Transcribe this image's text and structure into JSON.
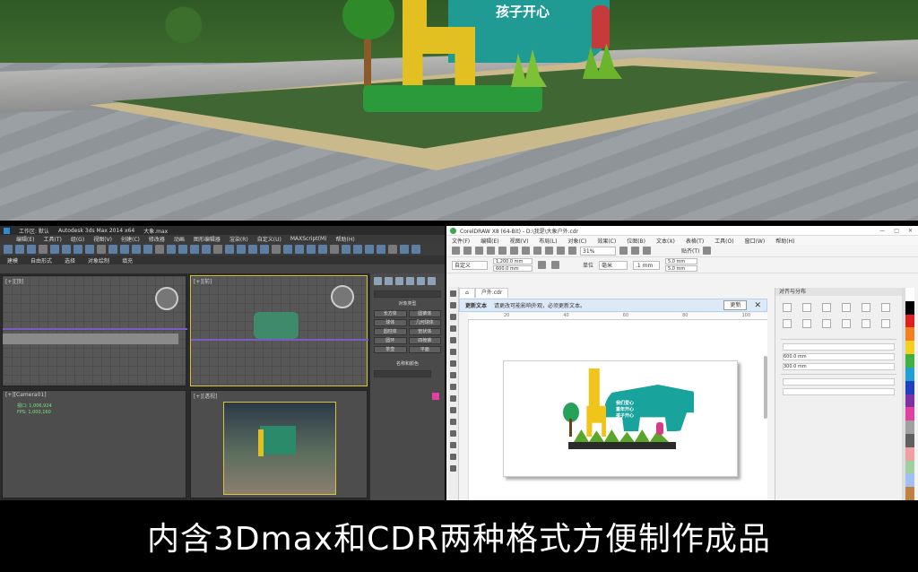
{
  "caption": "内含3Dmax和CDR两种格式方便制作成品",
  "render": {
    "sign_text": "孩子开心"
  },
  "max_app": {
    "title_tab": "工作区: 默认",
    "title_app": "Autodesk 3ds Max 2014 x64",
    "title_file": "大象.max",
    "menus": [
      "编辑(E)",
      "工具(T)",
      "组(G)",
      "视图(V)",
      "创建(C)",
      "修改器",
      "动画",
      "图形编辑器",
      "渲染(R)",
      "自定义(U)",
      "MAXScript(M)",
      "帮助(H)"
    ],
    "ribbon": [
      "建模",
      "自由形式",
      "选择",
      "对象绘制",
      "填充"
    ],
    "viewport_labels": [
      "[+][顶]",
      "[+][前]",
      "[+][Camera01]",
      "[+][透视]"
    ],
    "camera_readout": [
      "视口: 1,006,924",
      "FPS: 1,000,160"
    ],
    "panel_buttons": [
      "长方体",
      "圆锥体",
      "球体",
      "几何球体",
      "圆柱体",
      "管状体",
      "圆环",
      "四棱锥",
      "茶壶",
      "平面"
    ],
    "panel_title": "对象类型",
    "panel_name": "名称和颜色"
  },
  "cdr_app": {
    "title": "CorelDRAW X8 (64-Bit) - D:\\我是\\大象户外.cdr",
    "window_controls": [
      "—",
      "□",
      "✕"
    ],
    "menus": [
      "文件(F)",
      "编辑(E)",
      "视图(V)",
      "布局(L)",
      "对象(C)",
      "效果(C)",
      "位图(B)",
      "文本(X)",
      "表格(T)",
      "工具(O)",
      "窗口(W)",
      "帮助(H)"
    ],
    "zoom": "31%",
    "snap_label": "贴齐(T)",
    "preset": "自定义",
    "width": "1,200.0 mm",
    "height": "600.0 mm",
    "units": "单位",
    "units_value": "毫米",
    "nudge": ".1 mm",
    "dup_x": "5.0 mm",
    "dup_y": "5.0 mm",
    "doc_tab": "户外.cdr",
    "notice_title": "更新文本",
    "notice_text": "请更改可能影响外观，必须更新文本。",
    "notice_button": "更新",
    "ruler_marks": [
      "20",
      "40",
      "60",
      "80",
      "100",
      "120"
    ],
    "art_text": [
      "我们爱心",
      "童年开心",
      "孩子开心"
    ],
    "dock_title": "对齐与分布",
    "dock_size_w": "600.0 mm",
    "dock_size_h": "300.0 mm",
    "palette": [
      "#ffffff",
      "#000000",
      "#e02020",
      "#f08020",
      "#f5d020",
      "#40b040",
      "#20a0d0",
      "#2040c0",
      "#8030a0",
      "#e040a0",
      "#a0a0a0",
      "#606060",
      "#f0a0a0",
      "#a0d0a0",
      "#a0c0f0",
      "#c08040"
    ]
  }
}
